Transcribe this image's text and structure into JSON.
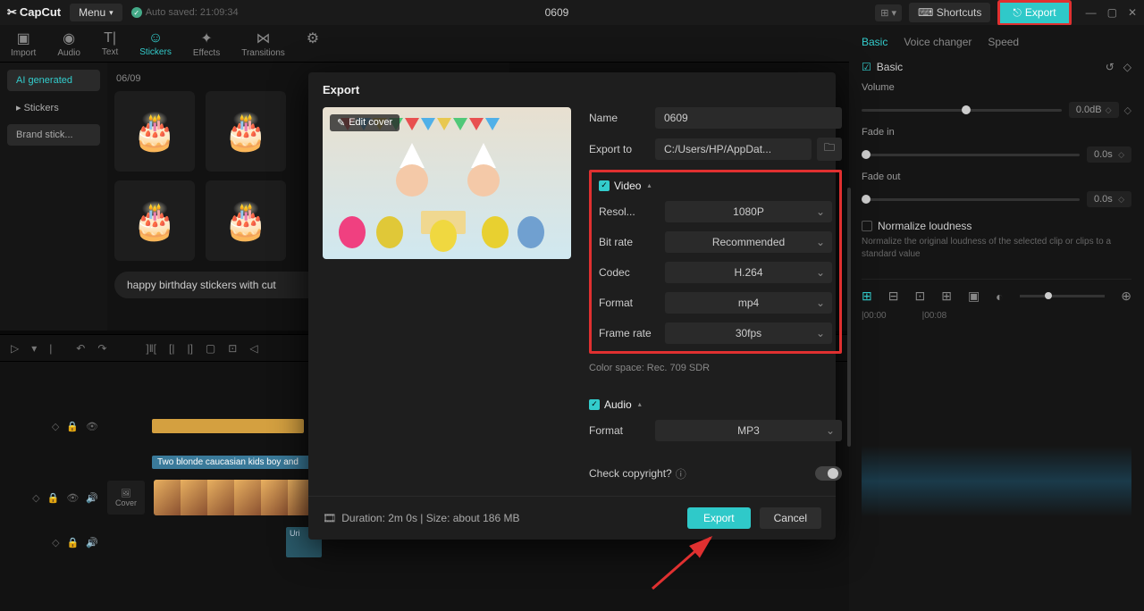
{
  "topbar": {
    "logo": "CapCut",
    "menu": "Menu",
    "autosave": "Auto saved: 21:09:34",
    "title": "0609",
    "shortcuts": "Shortcuts",
    "export": "Export"
  },
  "tooltabs": {
    "import": "Import",
    "audio": "Audio",
    "text": "Text",
    "stickers": "Stickers",
    "effects": "Effects",
    "transitions": "Transitions"
  },
  "left_panel": {
    "ai": "AI generated",
    "stickers": "Stickers",
    "brand": "Brand stick..."
  },
  "sticker_area": {
    "date": "06/09",
    "prompt": "happy birthday stickers with cut"
  },
  "right_panel": {
    "tabs": {
      "basic": "Basic",
      "voice": "Voice changer",
      "speed": "Speed"
    },
    "section": "Basic",
    "volume": {
      "label": "Volume",
      "value": "0.0dB"
    },
    "fadein": {
      "label": "Fade in",
      "value": "0.0s"
    },
    "fadeout": {
      "label": "Fade out",
      "value": "0.0s"
    },
    "normalize": {
      "title": "Normalize loudness",
      "desc": "Normalize the original loudness of the selected clip or clips to a standard value"
    },
    "time": {
      "t1": "|00:00",
      "t2": "|00:08"
    }
  },
  "timeline": {
    "clip_text": "Two blonde caucasian kids boy and",
    "cover": "Cover",
    "uri": "Uri"
  },
  "export_modal": {
    "title": "Export",
    "edit_cover": "Edit cover",
    "name": {
      "label": "Name",
      "value": "0609"
    },
    "export_to": {
      "label": "Export to",
      "value": "C:/Users/HP/AppDat..."
    },
    "video": {
      "title": "Video",
      "resolution": {
        "label": "Resol...",
        "value": "1080P"
      },
      "bitrate": {
        "label": "Bit rate",
        "value": "Recommended"
      },
      "codec": {
        "label": "Codec",
        "value": "H.264"
      },
      "format": {
        "label": "Format",
        "value": "mp4"
      },
      "framerate": {
        "label": "Frame rate",
        "value": "30fps"
      }
    },
    "colorspace": "Color space: Rec. 709 SDR",
    "audio": {
      "title": "Audio",
      "format": {
        "label": "Format",
        "value": "MP3"
      }
    },
    "copyright": "Check copyright?",
    "meta": "Duration: 2m 0s | Size: about 186 MB",
    "export_btn": "Export",
    "cancel_btn": "Cancel"
  }
}
